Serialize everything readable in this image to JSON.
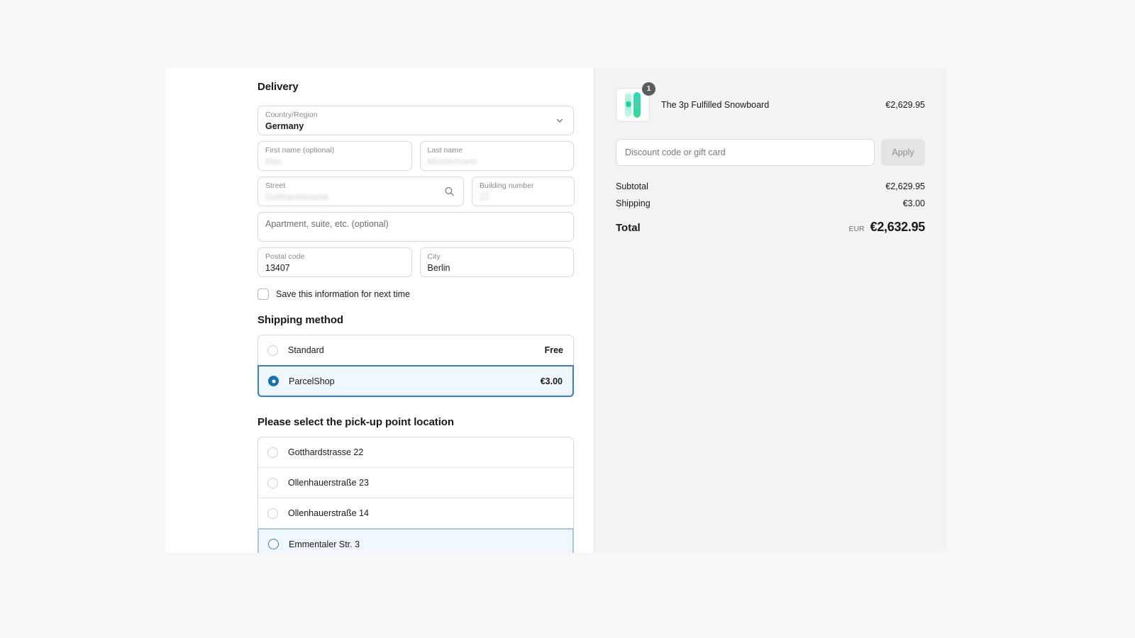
{
  "delivery": {
    "title": "Delivery",
    "country": {
      "label": "Country/Region",
      "value": "Germany",
      "icon": "chevron-down-icon"
    },
    "first_name": {
      "label": "First name (optional)",
      "value": "Max",
      "redacted": true
    },
    "last_name": {
      "label": "Last name",
      "value": "Mustermann",
      "redacted": true
    },
    "street": {
      "label": "Street",
      "value": "Gotthardstrasse",
      "redacted": true,
      "icon": "search-icon"
    },
    "building_number": {
      "label": "Building number",
      "value": "22",
      "redacted": true
    },
    "apartment": {
      "placeholder": "Apartment, suite, etc. (optional)",
      "value": ""
    },
    "postal_code": {
      "label": "Postal code",
      "value": "13407"
    },
    "city": {
      "label": "City",
      "value": "Berlin"
    },
    "save_info": {
      "label": "Save this information for next time",
      "checked": false
    }
  },
  "shipping": {
    "title": "Shipping method",
    "options": [
      {
        "label": "Standard",
        "price": "Free",
        "selected": false
      },
      {
        "label": "ParcelShop",
        "price": "€3.00",
        "selected": true
      }
    ]
  },
  "pickup": {
    "title": "Please select the pick-up point location",
    "options": [
      {
        "label": "Gotthardstrasse 22",
        "selected": false,
        "hovered": false
      },
      {
        "label": "Ollenhauerstraße 23",
        "selected": false,
        "hovered": false
      },
      {
        "label": "Ollenhauerstraße 14",
        "selected": false,
        "hovered": false
      },
      {
        "label": "Emmentaler Str. 3",
        "selected": false,
        "hovered": true
      }
    ]
  },
  "summary": {
    "line_item": {
      "name": "The 3p Fulfilled Snowboard",
      "price": "€2,629.95",
      "quantity": "1",
      "thumbnail_icon": "snowboard-pair-icon"
    },
    "discount": {
      "placeholder": "Discount code or gift card",
      "value": "",
      "apply_label": "Apply"
    },
    "subtotal": {
      "label": "Subtotal",
      "value": "€2,629.95"
    },
    "shipping": {
      "label": "Shipping",
      "value": "€3.00"
    },
    "total": {
      "label": "Total",
      "currency": "EUR",
      "value": "€2,632.95"
    }
  },
  "colors": {
    "accent_blue": "#1773b0",
    "selected_row_bg": "#f0f6ff",
    "selected_border": "#3c7fb8",
    "hover_border": "#a8c8e4",
    "page_bg": "#f7f7f7",
    "summary_bg": "#f3f3f3",
    "badge_bg": "#5c5c5c",
    "board_teal": "#2fd9c0",
    "board_mint": "#9fecd8"
  }
}
